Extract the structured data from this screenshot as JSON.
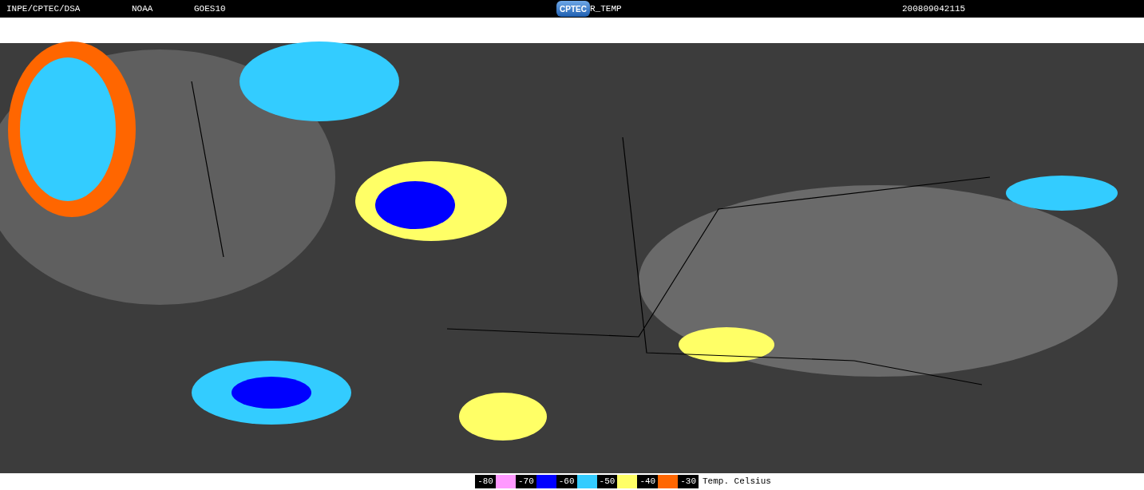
{
  "header": {
    "source": "INPE/CPTEC/DSA",
    "agency": "NOAA",
    "satellite": "GOES10",
    "logo": "CPTEC",
    "product": "R_TEMP",
    "timestamp": "200809042115"
  },
  "legend": {
    "steps": [
      {
        "label": "-80",
        "color": "#ff99ff"
      },
      {
        "label": "-70",
        "color": "#0000ff"
      },
      {
        "label": "-60",
        "color": "#33ccff"
      },
      {
        "label": "-50",
        "color": "#ffff66"
      },
      {
        "label": "-40",
        "color": "#ff6600"
      },
      {
        "label": "-30"
      }
    ],
    "unit": "Temp. Celsius"
  }
}
